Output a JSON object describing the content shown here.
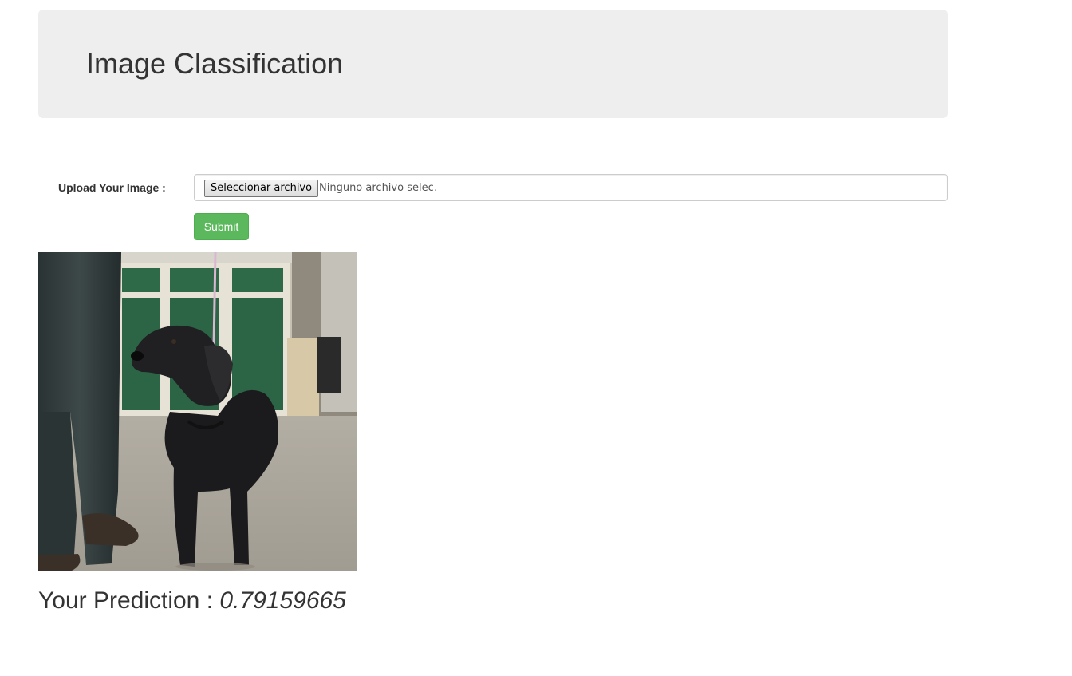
{
  "header": {
    "title": "Image Classification"
  },
  "upload_form": {
    "label": "Upload Your Image :",
    "file_button_label": "Seleccionar archivo",
    "file_status": "Ninguno archivo selec.",
    "submit_label": "Submit"
  },
  "result": {
    "prediction_label": "Your Prediction :",
    "prediction_value": "0.79159665"
  },
  "colors": {
    "jumbotron_bg": "#eeeeee",
    "submit_bg": "#5cb85c",
    "text": "#333333"
  },
  "icons": {
    "uploaded_image": "dog-photo"
  }
}
